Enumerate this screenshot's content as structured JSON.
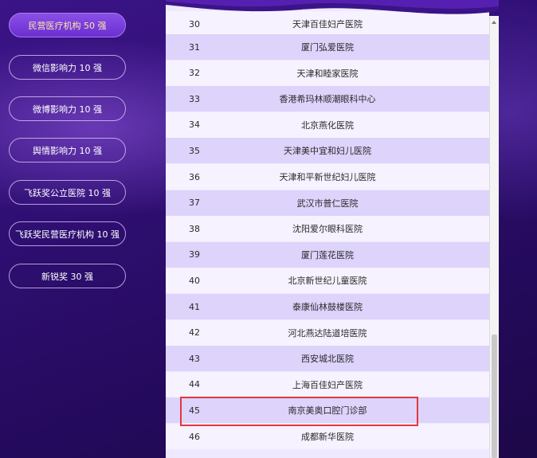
{
  "sidebar": {
    "items": [
      {
        "label": "民营医疗机构 50 强",
        "active": true
      },
      {
        "label": "微信影响力 10 强",
        "active": false
      },
      {
        "label": "微博影响力 10 强",
        "active": false
      },
      {
        "label": "舆情影响力 10 强",
        "active": false
      },
      {
        "label": "飞跃奖公立医院 10 强",
        "active": false
      },
      {
        "label": "飞跃奖民营医疗机构 10 强",
        "active": false
      },
      {
        "label": "新锐奖 30 强",
        "active": false
      }
    ]
  },
  "table": {
    "partial_row": {
      "num": "30",
      "name": "天津百佳妇产医院"
    },
    "rows": [
      {
        "num": "31",
        "name": "厦门弘爱医院"
      },
      {
        "num": "32",
        "name": "天津和睦家医院"
      },
      {
        "num": "33",
        "name": "香港希玛林顺潮眼科中心"
      },
      {
        "num": "34",
        "name": "北京燕化医院"
      },
      {
        "num": "35",
        "name": "天津美中宜和妇儿医院"
      },
      {
        "num": "36",
        "name": "天津和平新世纪妇儿医院"
      },
      {
        "num": "37",
        "name": "武汉市普仁医院"
      },
      {
        "num": "38",
        "name": "沈阳爱尔眼科医院"
      },
      {
        "num": "39",
        "name": "厦门莲花医院"
      },
      {
        "num": "40",
        "name": "北京新世纪儿童医院"
      },
      {
        "num": "41",
        "name": "泰康仙林鼓楼医院"
      },
      {
        "num": "42",
        "name": "河北燕达陆道培医院"
      },
      {
        "num": "43",
        "name": "西安城北医院"
      },
      {
        "num": "44",
        "name": "上海百佳妇产医院"
      },
      {
        "num": "45",
        "name": "南京美奥口腔门诊部"
      },
      {
        "num": "46",
        "name": "成都新华医院"
      }
    ]
  },
  "colors": {
    "accent": "#7a3fe0",
    "highlight": "#e0393e"
  }
}
